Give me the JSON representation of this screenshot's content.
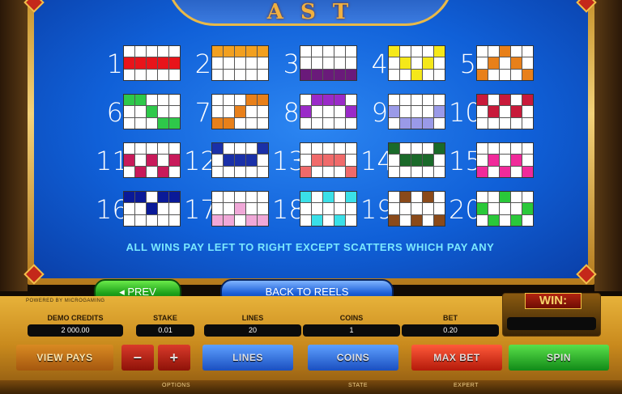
{
  "game": {
    "logo_text": "A  S  T"
  },
  "paylines": [
    {
      "n": "1",
      "color": "#e8141a",
      "cells": [
        5,
        6,
        7,
        8,
        9
      ]
    },
    {
      "n": "2",
      "color": "#f2a020",
      "cells": [
        0,
        1,
        2,
        3,
        4
      ]
    },
    {
      "n": "3",
      "color": "#6a1a7a",
      "cells": [
        10,
        11,
        12,
        13,
        14
      ]
    },
    {
      "n": "4",
      "color": "#f5e81a",
      "cells": [
        0,
        6,
        12,
        8,
        4
      ]
    },
    {
      "n": "5",
      "color": "#e8801a",
      "cells": [
        10,
        6,
        2,
        8,
        14
      ]
    },
    {
      "n": "6",
      "color": "#2ec84a",
      "cells": [
        0,
        1,
        7,
        13,
        14
      ]
    },
    {
      "n": "7",
      "color": "#e8801a",
      "cells": [
        10,
        11,
        7,
        3,
        4
      ]
    },
    {
      "n": "8",
      "color": "#9a2ac8",
      "cells": [
        5,
        1,
        2,
        3,
        9
      ]
    },
    {
      "n": "9",
      "color": "#9a9ae8",
      "cells": [
        5,
        11,
        12,
        13,
        9
      ]
    },
    {
      "n": "10",
      "color": "#c81a3a",
      "cells": [
        0,
        6,
        2,
        8,
        4
      ]
    },
    {
      "n": "11",
      "color": "#c81a5a",
      "cells": [
        5,
        11,
        7,
        13,
        9
      ]
    },
    {
      "n": "12",
      "color": "#1a30a8",
      "cells": [
        0,
        6,
        7,
        8,
        4
      ]
    },
    {
      "n": "13",
      "color": "#f06a6a",
      "cells": [
        10,
        6,
        7,
        8,
        14
      ]
    },
    {
      "n": "14",
      "color": "#1a6a2a",
      "cells": [
        0,
        6,
        7,
        8,
        4
      ]
    },
    {
      "n": "15",
      "color": "#f02a9a",
      "cells": [
        10,
        6,
        12,
        8,
        14
      ]
    },
    {
      "n": "16",
      "color": "#0a1a98",
      "cells": [
        0,
        1,
        7,
        3,
        4
      ]
    },
    {
      "n": "17",
      "color": "#f0a8d8",
      "cells": [
        10,
        11,
        7,
        13,
        14
      ]
    },
    {
      "n": "18",
      "color": "#3ae0e8",
      "cells": [
        0,
        11,
        2,
        13,
        4
      ]
    },
    {
      "n": "19",
      "color": "#8a4a1a",
      "cells": [
        10,
        1,
        12,
        3,
        14
      ]
    },
    {
      "n": "20",
      "color": "#2ac83a",
      "cells": [
        5,
        11,
        2,
        13,
        9
      ]
    }
  ],
  "pay_note": "ALL WINS PAY LEFT TO RIGHT EXCEPT SCATTERS WHICH PAY ANY",
  "nav": {
    "prev_label": "PREV",
    "back_label": "BACK TO REELS"
  },
  "console": {
    "powered": "POWERED BY MICROGAMING",
    "demo_label": "DEMO CREDITS",
    "demo_value": "2 000.00",
    "stake_label": "STAKE",
    "stake_value": "0.01",
    "lines_label": "LINES",
    "lines_value": "20",
    "coins_label": "COINS",
    "coins_value": "1",
    "bet_label": "BET",
    "bet_value": "0.20",
    "win_label": "WIN:",
    "view_pays": "VIEW PAYS",
    "minus": "−",
    "plus": "+",
    "lines_btn": "LINES",
    "coins_btn": "COINS",
    "maxbet_btn": "MAX BET",
    "spin_btn": "SPIN",
    "options": "OPTIONS",
    "state": "STATE",
    "expert": "EXPERT"
  }
}
